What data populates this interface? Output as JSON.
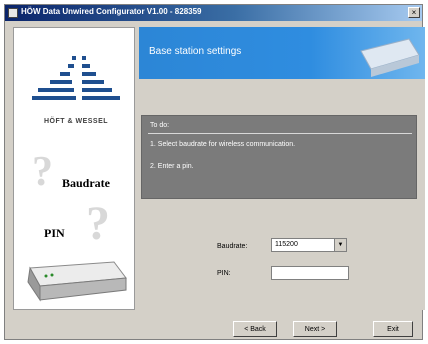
{
  "window": {
    "title": "HÖW Data Unwired Configurator V1.00 - 828359",
    "close_glyph": "×"
  },
  "sidebar": {
    "logo_text": "HÖFT & WESSEL",
    "baudrate_label": "Baudrate",
    "pin_label": "PIN",
    "question_glyph": "?"
  },
  "header": {
    "title": "Base station settings"
  },
  "todo": {
    "title": "To do:",
    "steps": [
      "1. Select baudrate for wireless communication.",
      "2. Enter a pin."
    ]
  },
  "form": {
    "baudrate_label": "Baudrate:",
    "baudrate_value": "115200",
    "pin_label": "PIN:",
    "pin_value": ""
  },
  "buttons": {
    "back": "< Back",
    "next": "Next >",
    "exit": "Exit"
  },
  "icons": {
    "dropdown": "chevron-down-icon"
  }
}
